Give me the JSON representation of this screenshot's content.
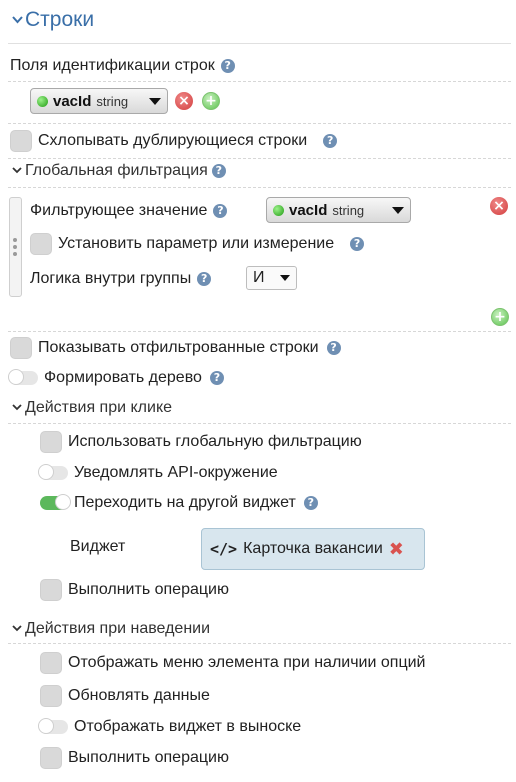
{
  "section": {
    "title": "Строки"
  },
  "row_id": {
    "label": "Поля идентификации строк",
    "field": {
      "name": "vacId",
      "type": "string"
    }
  },
  "collapse_duplicates": {
    "label": "Схлопывать дублирующиеся строки"
  },
  "global_filter": {
    "title": "Глобальная фильтрация",
    "filter_value_label": "Фильтрующее значение",
    "field": {
      "name": "vacId",
      "type": "string"
    },
    "set_param_label": "Установить параметр или измерение",
    "group_logic_label": "Логика внутри группы",
    "group_logic_value": "И"
  },
  "show_filtered": {
    "label": "Показывать отфильтрованные строки"
  },
  "build_tree": {
    "label": "Формировать дерево"
  },
  "click_actions": {
    "title": "Действия при клике",
    "use_global_filter": "Использовать глобальную фильтрацию",
    "notify_api": "Уведомлять API-окружение",
    "go_to_widget": "Переходить на другой виджет",
    "widget_label": "Виджет",
    "widget_value": "Карточка вакансии",
    "run_operation": "Выполнить операцию"
  },
  "hover_actions": {
    "title": "Действия при наведении",
    "show_menu": "Отображать меню элемента при наличии опций",
    "refresh_data": "Обновлять данные",
    "show_widget_tooltip": "Отображать виджет в выноске",
    "run_operation": "Выполнить операцию"
  },
  "icons": {
    "help": "?",
    "remove": "×",
    "add": "+"
  },
  "colors": {
    "accent": "#3a6fa8",
    "remove": "#d23c3c",
    "add": "#5cc34e",
    "toggle_on": "#5cb85c"
  }
}
